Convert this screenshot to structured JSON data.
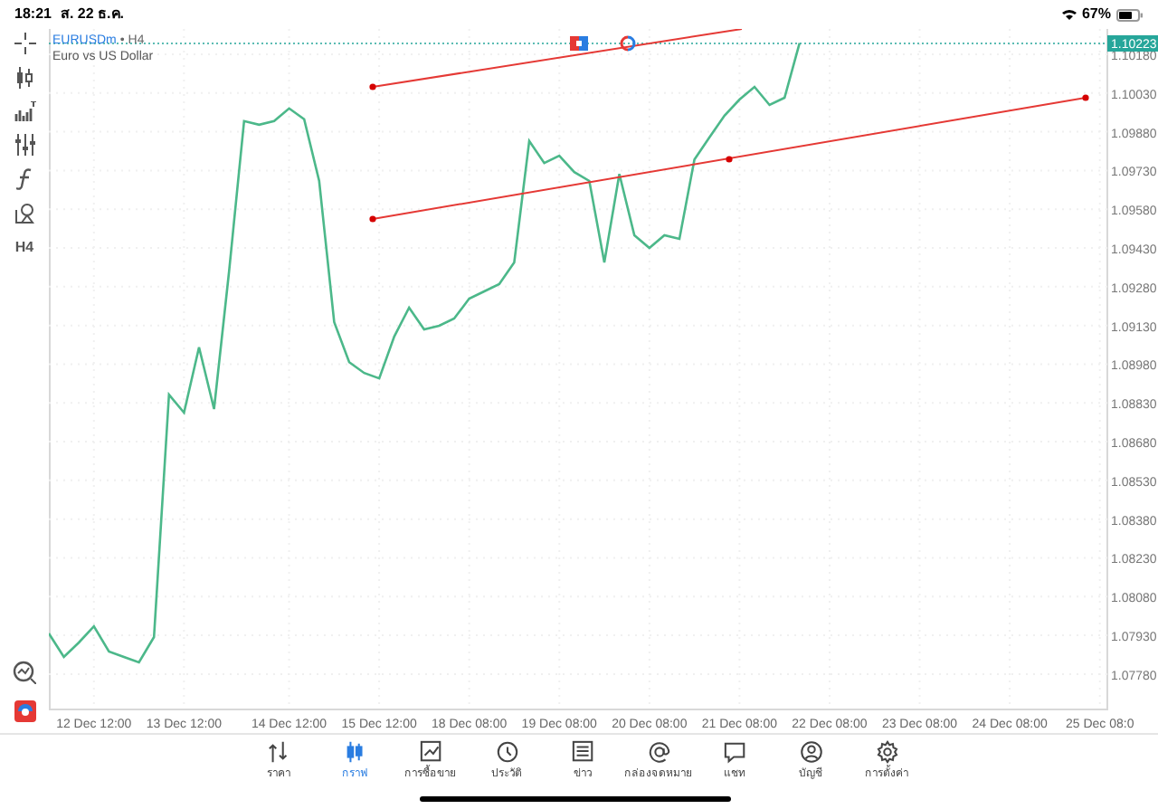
{
  "status_bar": {
    "time": "18:21",
    "date": "ส. 22 ธ.ค.",
    "battery": "67%"
  },
  "toolbar": [
    {
      "kind": "crosshair"
    },
    {
      "kind": "candles"
    },
    {
      "kind": "indicators"
    },
    {
      "kind": "sliders"
    },
    {
      "kind": "function"
    },
    {
      "kind": "objects"
    },
    {
      "kind": "timeframe",
      "label": "H4"
    }
  ],
  "toolbar_bottom": [
    {
      "kind": "chart-check"
    },
    {
      "kind": "logo"
    }
  ],
  "chart": {
    "timeframe": "• H4",
    "description": "Euro vs US Dollar",
    "chart_data": {
      "type": "line",
      "grid": true,
      "categories": [
        null,
        null,
        null,
        "12 Dec 12:00",
        null,
        null,
        null,
        null,
        null,
        "13 Dec 12:00",
        null,
        null,
        null,
        null,
        null,
        null,
        "14 Dec 12:00",
        null,
        null,
        null,
        null,
        null,
        "15 Dec 12:00",
        null,
        null,
        null,
        null,
        null,
        "18 Dec 08:00",
        null,
        null,
        null,
        null,
        null,
        "19 Dec 08:00",
        null,
        null,
        null,
        null,
        null,
        "20 Dec 08:00",
        null,
        null,
        null,
        null,
        null,
        "21 Dec 08:00",
        null,
        null,
        null,
        null,
        null,
        "22 Dec 08:00",
        null,
        null,
        null,
        null,
        null,
        "23 Dec 08:00",
        null,
        null,
        null,
        null,
        null,
        "24 Dec 08:00",
        null,
        null,
        null,
        null,
        null,
        "25 Dec 08:0"
      ],
      "series": [
        {
          "name": "EURUSDm",
          "color": "#4cb88a",
          "values": [
            1.07937,
            1.07846,
            1.07902,
            1.07965,
            1.07867,
            1.07846,
            1.07825,
            1.07923,
            1.08862,
            1.08792,
            1.09045,
            1.08806,
            1.09339,
            1.09921,
            1.09907,
            1.09921,
            1.0997,
            1.09928,
            1.09689,
            1.09143,
            1.08988,
            1.08946,
            1.08925,
            1.09087,
            1.09199,
            1.09115,
            1.09129,
            1.09157,
            1.09234,
            1.09262,
            1.0929,
            1.09374,
            1.09844,
            1.09759,
            1.09787,
            1.09724,
            1.09689,
            1.09374,
            1.09717,
            1.09479,
            1.0943,
            1.09479,
            1.09465,
            1.09773,
            1.09858,
            1.09942,
            1.10005,
            1.10054,
            1.09984,
            1.10012,
            1.10223,
            null,
            null,
            null,
            null,
            null,
            null,
            null,
            null,
            null,
            null,
            null,
            null,
            null,
            null,
            null,
            null,
            null,
            null,
            null,
            null
          ]
        }
      ],
      "yticks": [
        {
          "value": 1.0778,
          "label": "1.07780"
        },
        {
          "value": 1.0793,
          "label": "1.07930"
        },
        {
          "value": 1.0808,
          "label": "1.08080"
        },
        {
          "value": 1.0823,
          "label": "1.08230"
        },
        {
          "value": 1.0838,
          "label": "1.08380"
        },
        {
          "value": 1.0853,
          "label": "1.08530"
        },
        {
          "value": 1.0868,
          "label": "1.08680"
        },
        {
          "value": 1.0883,
          "label": "1.08830"
        },
        {
          "value": 1.0898,
          "label": "1.08980"
        },
        {
          "value": 1.0913,
          "label": "1.09130"
        },
        {
          "value": 1.0928,
          "label": "1.09280"
        },
        {
          "value": 1.0943,
          "label": "1.09430"
        },
        {
          "value": 1.0958,
          "label": "1.09580"
        },
        {
          "value": 1.0973,
          "label": "1.09730"
        },
        {
          "value": 1.0988,
          "label": "1.09880"
        },
        {
          "value": 1.1003,
          "label": "1.10030"
        },
        {
          "value": 1.1018,
          "label": "1.10180"
        }
      ],
      "ylim": [
        1.07643,
        1.10278
      ]
    },
    "current_price": "1.10223"
  },
  "tabs": [
    {
      "kind": "quotes",
      "label": "ราคา",
      "selected": false
    },
    {
      "kind": "chart",
      "label": "กราฟ",
      "selected": true
    },
    {
      "kind": "trade",
      "label": "การซื้อขาย",
      "selected": false
    },
    {
      "kind": "history",
      "label": "ประวัติ",
      "selected": false
    },
    {
      "kind": "news",
      "label": "ข่าว",
      "selected": false
    },
    {
      "kind": "mailbox",
      "label": "กล่องจดหมาย",
      "selected": false
    },
    {
      "kind": "chat",
      "label": "แชท",
      "selected": false
    },
    {
      "kind": "account",
      "label": "บัญชี",
      "selected": false
    },
    {
      "kind": "settings",
      "label": "การตั้งค่า",
      "selected": false
    }
  ]
}
